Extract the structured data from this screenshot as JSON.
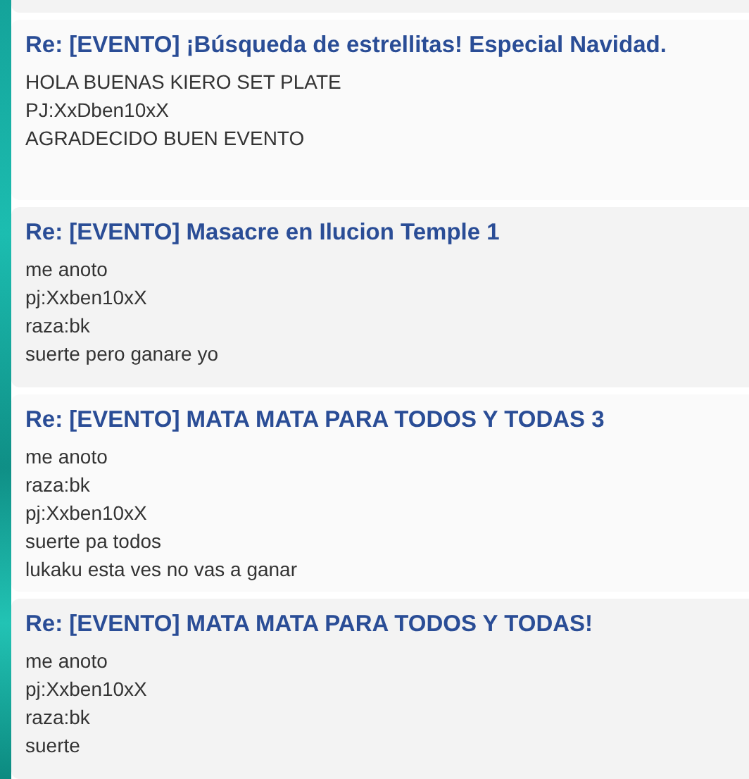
{
  "posts": [
    {
      "title": "Re: [EVENTO] ¡Búsqueda de estrellitas! Especial Navidad.",
      "lines": [
        "HOLA BUENAS KIERO SET PLATE",
        "PJ:XxDben10xX",
        "AGRADECIDO BUEN EVENTO"
      ]
    },
    {
      "title": "Re: [EVENTO] Masacre en Ilucion Temple 1",
      "lines": [
        "me anoto",
        "pj:Xxben10xX",
        "raza:bk",
        "suerte pero ganare yo"
      ]
    },
    {
      "title": "Re: [EVENTO] MATA MATA PARA TODOS Y TODAS 3",
      "lines": [
        "me anoto",
        "raza:bk",
        "pj:Xxben10xX",
        "suerte pa todos",
        "lukaku esta ves no vas a ganar"
      ]
    },
    {
      "title": "Re: [EVENTO] MATA MATA PARA TODOS Y TODAS!",
      "lines": [
        "me anoto",
        "pj:Xxben10xX",
        "raza:bk",
        "suerte"
      ]
    }
  ]
}
